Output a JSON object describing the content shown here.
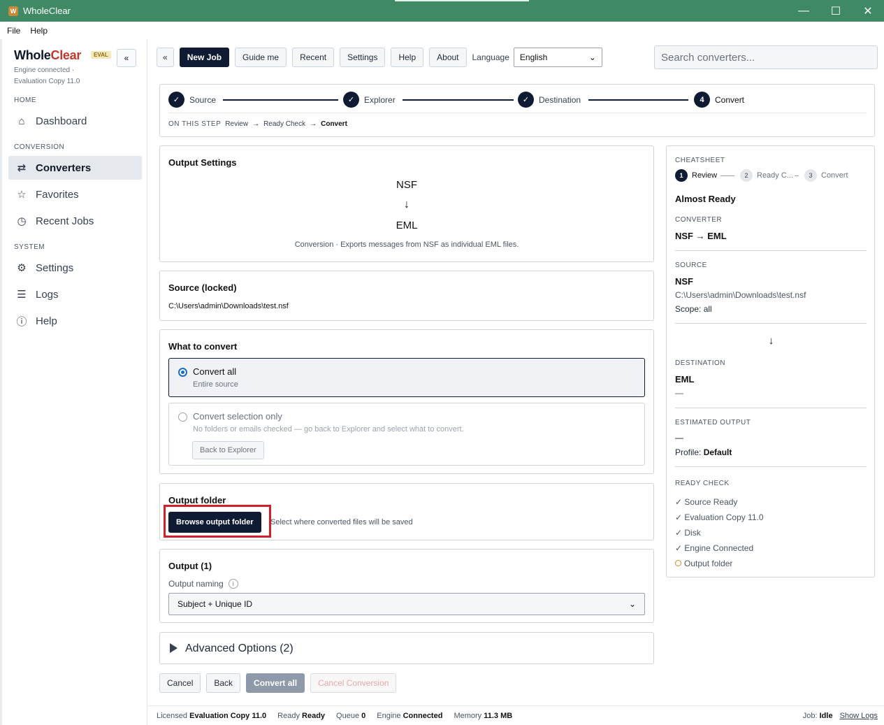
{
  "window": {
    "title": "WholeClear",
    "minimize": "—",
    "maximize": "☐",
    "close": "✕"
  },
  "menu": [
    "File",
    "Help"
  ],
  "sidebar": {
    "brand_a": "Whole",
    "brand_b": "Clear",
    "badge": "EVAL",
    "collapse": "«",
    "engine_status": "Engine connected · Evaluation Copy 11.0",
    "sections": {
      "home": "HOME",
      "conversion": "CONVERSION",
      "system": "SYSTEM"
    },
    "items": {
      "dashboard": "Dashboard",
      "converters": "Converters",
      "favorites": "Favorites",
      "recent_jobs": "Recent Jobs",
      "settings": "Settings",
      "logs": "Logs",
      "help": "Help"
    }
  },
  "toolbar": {
    "back": "«",
    "new_job": "New Job",
    "guide_me": "Guide me",
    "recent": "Recent",
    "settings": "Settings",
    "help": "Help",
    "about": "About",
    "language_label": "Language",
    "language_value": "English",
    "search_placeholder": "Search converters..."
  },
  "stepper": {
    "steps": [
      {
        "label": "Source",
        "mark": "✓"
      },
      {
        "label": "Explorer",
        "mark": "✓"
      },
      {
        "label": "Destination",
        "mark": "✓"
      },
      {
        "label": "Convert",
        "mark": "4"
      }
    ],
    "on_this_step_label": "ON THIS STEP",
    "sub_steps": [
      "Review",
      "Ready Check",
      "Convert"
    ],
    "arrow": "→"
  },
  "output_settings": {
    "title": "Output Settings",
    "from": "NSF",
    "arrow": "↓",
    "to": "EML",
    "description": "Conversion · Exports messages from NSF as individual EML files."
  },
  "source": {
    "title": "Source (locked)",
    "path": "C:\\Users\\admin\\Downloads\\test.nsf"
  },
  "what_to_convert": {
    "title": "What to convert",
    "all_title": "Convert all",
    "all_sub": "Entire source",
    "selection_title": "Convert selection only",
    "selection_sub": "No folders or emails checked — go back to Explorer and select what to convert.",
    "back_to_explorer": "Back to Explorer"
  },
  "output_folder": {
    "title": "Output folder",
    "browse": "Browse output folder",
    "hint": "Select where converted files will be saved"
  },
  "output": {
    "title": "Output (1)",
    "naming_label": "Output naming",
    "info": "i",
    "naming_value": "Subject + Unique ID"
  },
  "advanced": {
    "title": "Advanced Options (2)"
  },
  "bottom": {
    "cancel": "Cancel",
    "back": "Back",
    "convert_all": "Convert all",
    "cancel_conversion": "Cancel Conversion"
  },
  "cheatsheet": {
    "label": "CHEATSHEET",
    "steps": [
      {
        "n": "1",
        "label": "Review"
      },
      {
        "n": "2",
        "label": "Ready C..."
      },
      {
        "n": "3",
        "label": "Convert"
      }
    ],
    "heading": "Almost Ready",
    "converter_label": "CONVERTER",
    "converter_value": "NSF → EML",
    "source_label": "SOURCE",
    "source_type": "NSF",
    "source_path": "C:\\Users\\admin\\Downloads\\test.nsf",
    "source_scope": "Scope: all",
    "arrow": "↓",
    "destination_label": "DESTINATION",
    "destination_type": "EML",
    "destination_value": "—",
    "estimated_label": "ESTIMATED OUTPUT",
    "estimated_value": "—",
    "profile_label": "Profile:",
    "profile_value": "Default",
    "ready_label": "READY CHECK",
    "checks": [
      "✓ Source Ready",
      "✓ Evaluation Copy 11.0",
      "✓ Disk",
      "✓ Engine Connected"
    ],
    "pending": "Output folder"
  },
  "status": {
    "licensed_label": "Licensed",
    "licensed_value": "Evaluation Copy 11.0",
    "ready_label": "Ready",
    "ready_value": "Ready",
    "queue_label": "Queue",
    "queue_value": "0",
    "engine_label": "Engine",
    "engine_value": "Connected",
    "memory_label": "Memory",
    "memory_value": "11.3 MB",
    "job_label": "Job:",
    "job_value": "Idle",
    "show_logs": "Show Logs"
  }
}
